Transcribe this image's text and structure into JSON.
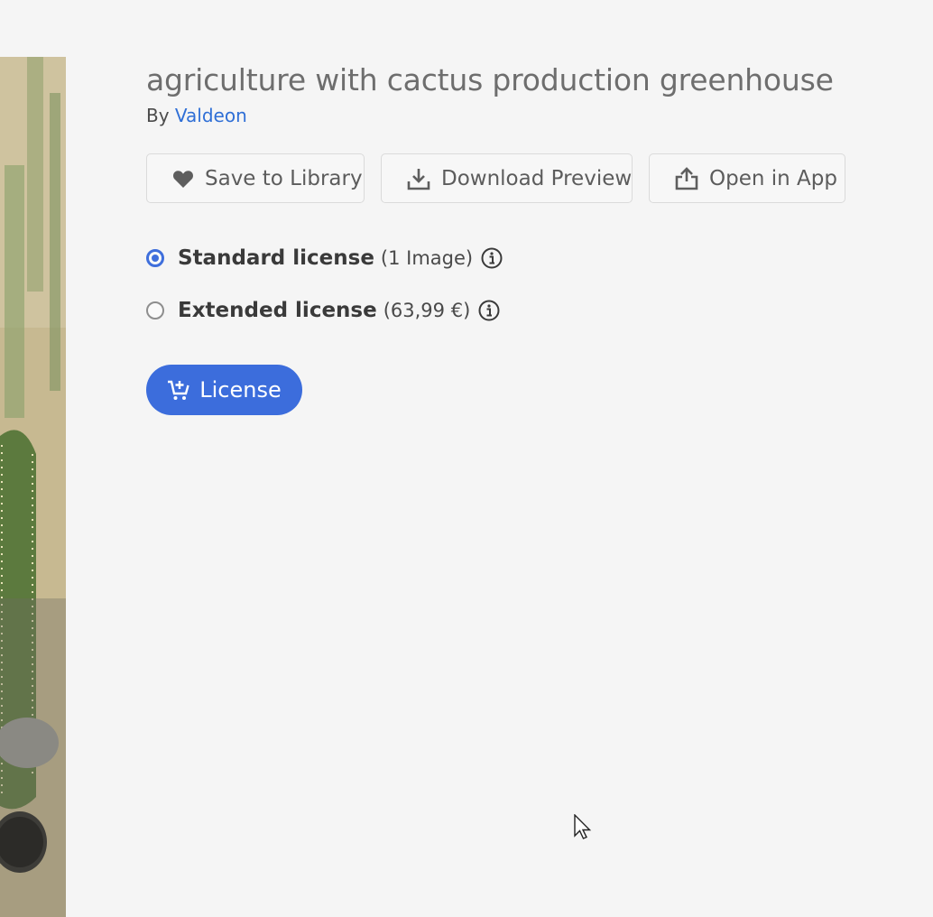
{
  "asset": {
    "title": "agriculture with cactus production greenhouse",
    "by_label": "By",
    "author": "Valdeon"
  },
  "actions": {
    "save_label": "Save to Library",
    "download_label": "Download Preview",
    "open_label": "Open in App"
  },
  "licenses": [
    {
      "name": "Standard license",
      "detail": "(1 Image)",
      "selected": true
    },
    {
      "name": "Extended license",
      "detail": "(63,99 €)",
      "selected": false
    }
  ],
  "cta": {
    "license_label": "License"
  },
  "icons": {
    "save": "heart-icon",
    "download": "download-icon",
    "open": "share-icon",
    "info": "info-icon",
    "cart": "cart-add-icon"
  },
  "colors": {
    "accent": "#3c6ddc",
    "link": "#2f6fd6",
    "background": "#f5f5f5"
  }
}
